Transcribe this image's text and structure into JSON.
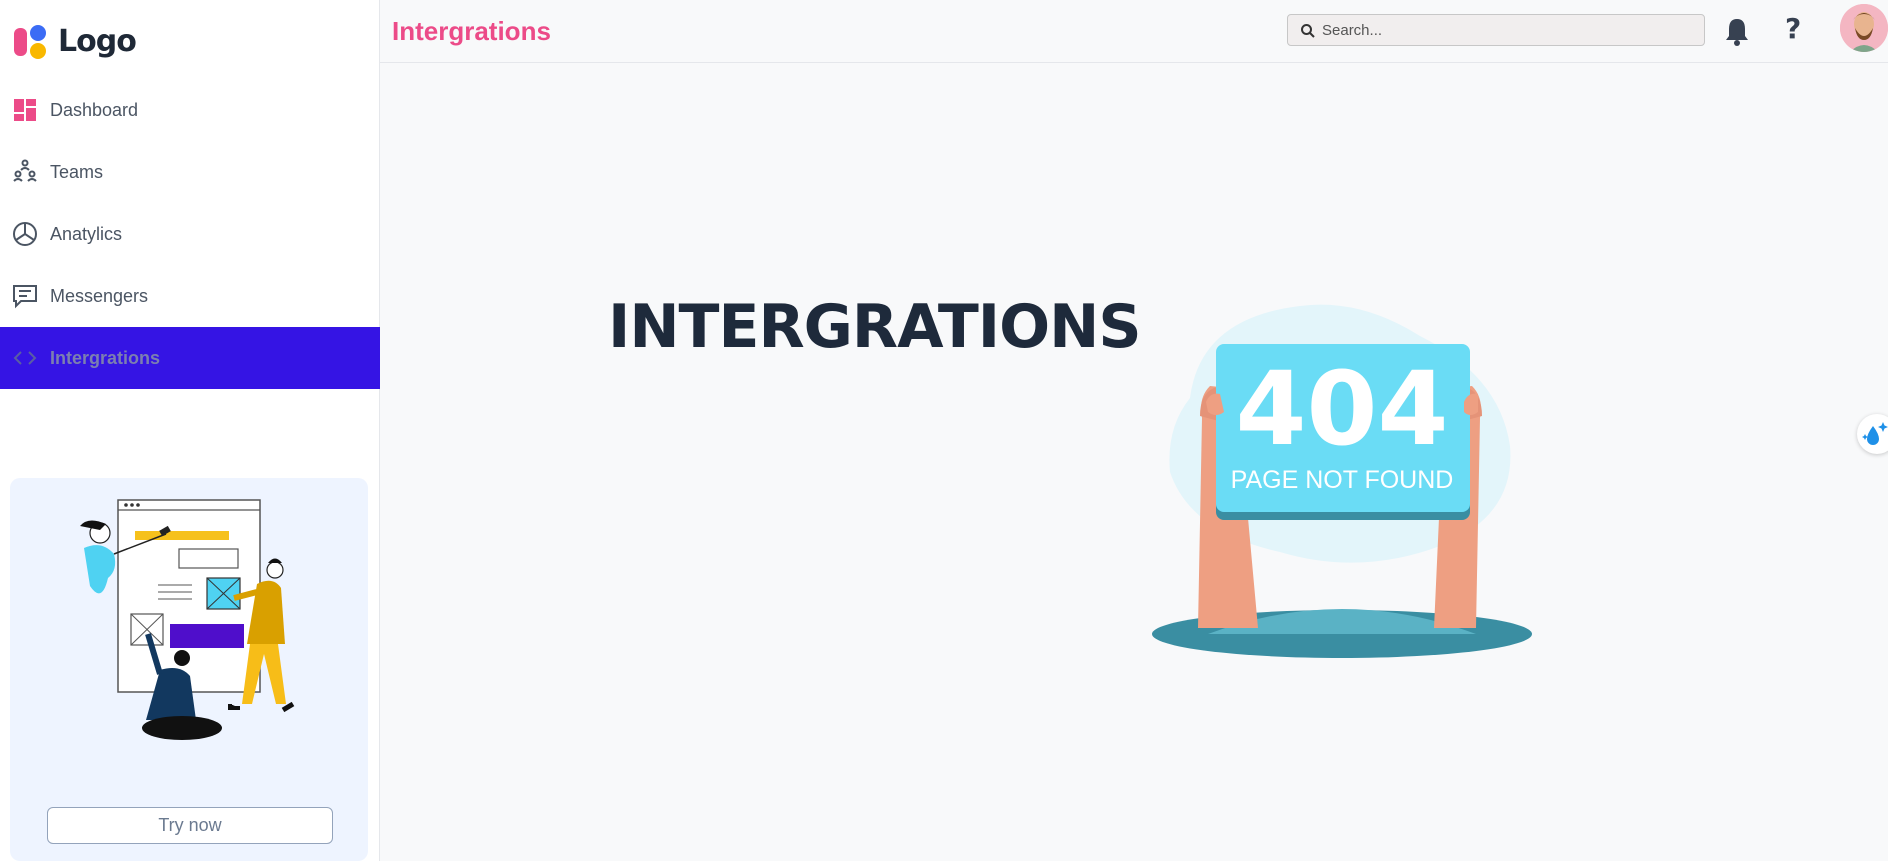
{
  "brand": {
    "logo_text": "Logo"
  },
  "sidebar": {
    "items": [
      {
        "label": "Dashboard",
        "icon": "dashboard-icon",
        "active": false
      },
      {
        "label": "Teams",
        "icon": "teams-icon",
        "active": false
      },
      {
        "label": "Anatylics",
        "icon": "analytics-icon",
        "active": false
      },
      {
        "label": "Messengers",
        "icon": "messengers-icon",
        "active": false
      },
      {
        "label": "Intergrations",
        "icon": "code-icon",
        "active": true
      }
    ],
    "promo": {
      "button_label": "Try now"
    }
  },
  "header": {
    "title": "Intergrations",
    "search": {
      "placeholder": "Search...",
      "value": ""
    },
    "help_label": "?"
  },
  "main": {
    "heading": "INTERGRATIONS",
    "error_code": "404",
    "error_text": "PAGE NOT FOUND"
  },
  "colors": {
    "accent": "#ec4b88",
    "active_nav": "#3514e4",
    "heading": "#1e2a3b",
    "sign": "#6adcf5"
  }
}
